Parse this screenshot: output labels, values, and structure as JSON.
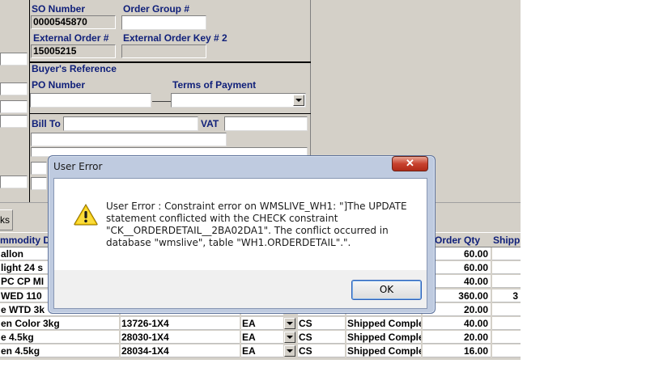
{
  "form": {
    "so_number_label": "SO Number",
    "so_number_value": "0000545870",
    "order_group_label": "Order Group #",
    "external_order_label": "External Order #",
    "external_order_value": "15005215",
    "external_order_key2_label": "External Order Key # 2",
    "buyers_reference_label": "Buyer's Reference",
    "po_number_label": "PO Number",
    "terms_of_payment_label": "Terms of Payment",
    "bill_to_label": "Bill To",
    "vat_label": "VAT"
  },
  "tab": {
    "label": "ks"
  },
  "grid": {
    "headers": {
      "commodity": "mmodity D",
      "order_qty": "Order Qty",
      "shipped": "Shipp"
    },
    "rows": [
      {
        "commodity": "allon",
        "sku": "",
        "uom": "",
        "pack": "",
        "status": "",
        "qty": "60.00",
        "extra": ""
      },
      {
        "commodity": "light 24 s",
        "sku": "",
        "uom": "",
        "pack": "",
        "status": "",
        "qty": "60.00",
        "extra": ""
      },
      {
        "commodity": "PC CP MI",
        "sku": "",
        "uom": "",
        "pack": "",
        "status": "",
        "qty": "40.00",
        "extra": ""
      },
      {
        "commodity": "WED 110",
        "sku": "",
        "uom": "",
        "pack": "",
        "status": "",
        "qty": "360.00",
        "extra": "3"
      },
      {
        "commodity": "e WTD 3k",
        "sku": "",
        "uom": "",
        "pack": "",
        "status": "",
        "qty": "20.00",
        "extra": ""
      },
      {
        "commodity": "en Color 3kg",
        "sku": "13726-1X4",
        "uom": "EA",
        "pack": "CS",
        "status": "Shipped Comple",
        "qty": "40.00",
        "extra": ""
      },
      {
        "commodity": "e 4.5kg",
        "sku": "28030-1X4",
        "uom": "EA",
        "pack": "CS",
        "status": "Shipped Comple",
        "qty": "20.00",
        "extra": ""
      },
      {
        "commodity": "en 4.5kg",
        "sku": "28034-1X4",
        "uom": "EA",
        "pack": "CS",
        "status": "Shipped Comple",
        "qty": "16.00",
        "extra": ""
      }
    ]
  },
  "dialog": {
    "title": "User Error",
    "close_glyph": "✕",
    "message": "User Error : Constraint error on WMSLIVE_WH1: \"]The UPDATE statement conflicted with the CHECK constraint \"CK__ORDERDETAIL__2BA02DA1\". The conflict occurred in database \"wmslive\", table \"WH1.ORDERDETAIL\".\".",
    "ok_label": "OK",
    "icon": "warning-icon"
  },
  "colors": {
    "app_bg": "#d4d0c8",
    "label_blue": "#10207a",
    "dialog_frame": "#bfcbe0",
    "close_red": "#c8422e"
  }
}
